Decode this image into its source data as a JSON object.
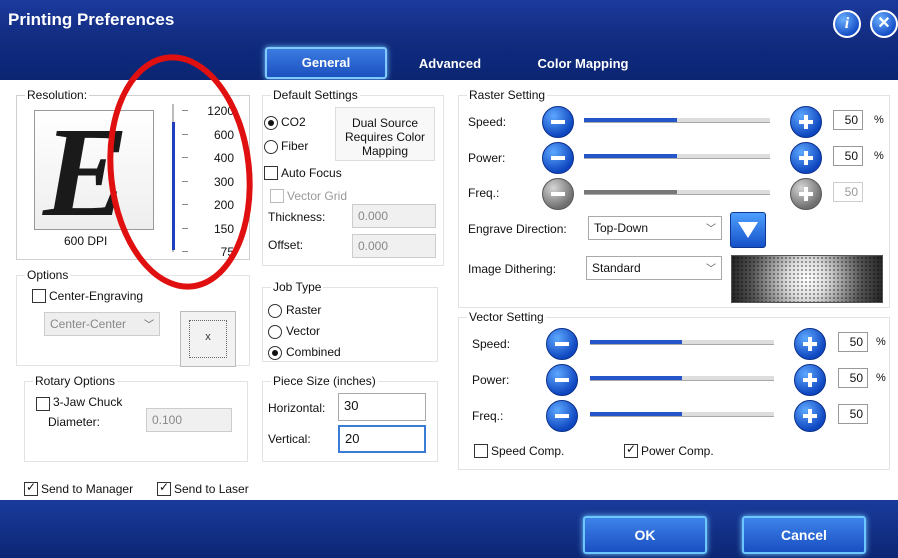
{
  "window": {
    "title": "Printing Preferences"
  },
  "tabs": [
    "General",
    "Advanced",
    "Color Mapping"
  ],
  "resolution": {
    "legend": "Resolution:",
    "preview_letter": "E",
    "current": "600 DPI",
    "levels": [
      "1200",
      "600",
      "400",
      "300",
      "200",
      "150",
      "75"
    ]
  },
  "default_settings": {
    "legend": "Default Settings",
    "co2": "CO2",
    "fiber": "Fiber",
    "note": "Dual Source Requires Color Mapping",
    "auto_focus": "Auto Focus",
    "vector_grid": "Vector Grid",
    "thickness_label": "Thickness:",
    "thickness_value": "0.000",
    "offset_label": "Offset:",
    "offset_value": "0.000"
  },
  "options": {
    "legend": "Options",
    "center_engraving": "Center-Engraving",
    "center_select": "Center-Center",
    "position_marker": "x"
  },
  "rotary": {
    "legend": "Rotary Options",
    "chuck": "3-Jaw Chuck",
    "diameter_label": "Diameter:",
    "diameter_value": "0.100"
  },
  "job_type": {
    "legend": "Job Type",
    "raster": "Raster",
    "vector": "Vector",
    "combined": "Combined"
  },
  "piece_size": {
    "legend": "Piece Size (inches)",
    "horizontal_label": "Horizontal:",
    "horizontal_value": "30",
    "vertical_label": "Vertical:",
    "vertical_value": "20"
  },
  "raster": {
    "legend": "Raster Setting",
    "speed_label": "Speed:",
    "speed": "50",
    "speed_fill": 0.5,
    "power_label": "Power:",
    "power": "50",
    "power_fill": 0.5,
    "freq_label": "Freq.:",
    "freq": "50",
    "freq_fill": 0.5,
    "pct": "%",
    "direction_label": "Engrave Direction:",
    "direction": "Top-Down",
    "dither_label": "Image Dithering:",
    "dither": "Standard"
  },
  "vector": {
    "legend": "Vector Setting",
    "speed_label": "Speed:",
    "speed": "50",
    "speed_fill": 0.5,
    "power_label": "Power:",
    "power": "50",
    "power_fill": 0.5,
    "freq_label": "Freq.:",
    "freq": "50",
    "freq_fill": 0.5,
    "pct": "%",
    "speed_comp": "Speed Comp.",
    "power_comp": "Power Comp."
  },
  "footer": {
    "send_manager": "Send to Manager",
    "send_laser": "Send to Laser",
    "ok": "OK",
    "cancel": "Cancel"
  },
  "colors": {
    "accent": "#1c51c0",
    "annotation": "#e01010"
  }
}
